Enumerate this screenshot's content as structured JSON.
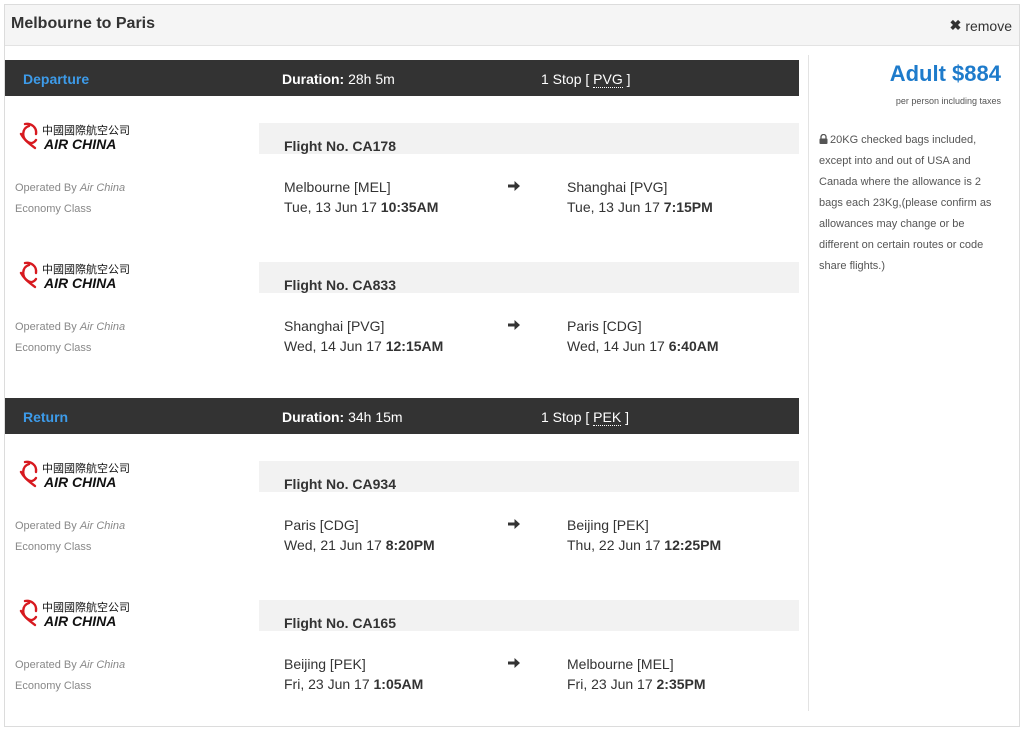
{
  "header": {
    "title": "Melbourne to Paris",
    "remove_label": "remove"
  },
  "legs": [
    {
      "label": "Departure",
      "duration_label": "Duration:",
      "duration": "28h 5m",
      "stops_label": "1 Stop [",
      "stop_code": "PVG",
      "stops_close": "]",
      "flights": [
        {
          "airline_logo": "AIR CHINA",
          "flight_no": "Flight No. CA178",
          "operated_prefix": "Operated By",
          "operated_by": "Air China",
          "cabin": "Economy Class",
          "from_place": "Melbourne [MEL]",
          "from_date": "Tue, 13 Jun 17",
          "from_time": "10:35AM",
          "to_place": "Shanghai [PVG]",
          "to_date": "Tue, 13 Jun 17",
          "to_time": "7:15PM"
        },
        {
          "airline_logo": "AIR CHINA",
          "flight_no": "Flight No. CA833",
          "operated_prefix": "Operated By",
          "operated_by": "Air China",
          "cabin": "Economy Class",
          "from_place": "Shanghai [PVG]",
          "from_date": "Wed, 14 Jun 17",
          "from_time": "12:15AM",
          "to_place": "Paris [CDG]",
          "to_date": "Wed, 14 Jun 17",
          "to_time": "6:40AM"
        }
      ]
    },
    {
      "label": "Return",
      "duration_label": "Duration:",
      "duration": "34h 15m",
      "stops_label": "1 Stop [",
      "stop_code": "PEK",
      "stops_close": "]",
      "flights": [
        {
          "airline_logo": "AIR CHINA",
          "flight_no": "Flight No. CA934",
          "operated_prefix": "Operated By",
          "operated_by": "Air China",
          "cabin": "Economy Class",
          "from_place": "Paris [CDG]",
          "from_date": "Wed, 21 Jun 17",
          "from_time": "8:20PM",
          "to_place": "Beijing [PEK]",
          "to_date": "Thu, 22 Jun 17",
          "to_time": "12:25PM"
        },
        {
          "airline_logo": "AIR CHINA",
          "flight_no": "Flight No. CA165",
          "operated_prefix": "Operated By",
          "operated_by": "Air China",
          "cabin": "Economy Class",
          "from_place": "Beijing [PEK]",
          "from_date": "Fri, 23 Jun 17",
          "from_time": "1:05AM",
          "to_place": "Melbourne [MEL]",
          "to_date": "Fri, 23 Jun 17",
          "to_time": "2:35PM"
        }
      ]
    }
  ],
  "sidebar": {
    "price": "Adult $884",
    "price_note": "per person including taxes",
    "baggage_icon": "lock-icon",
    "baggage": "20KG checked bags included, except into and out of USA and Canada where the allowance is 2 bags each 23Kg,(please confirm as allowances may change or be different on certain routes or code share flights.)"
  },
  "colors": {
    "leg_label": "#3d9be9",
    "price": "#1e7bcb",
    "bar": "#333333",
    "logo_red": "#d7191f"
  }
}
